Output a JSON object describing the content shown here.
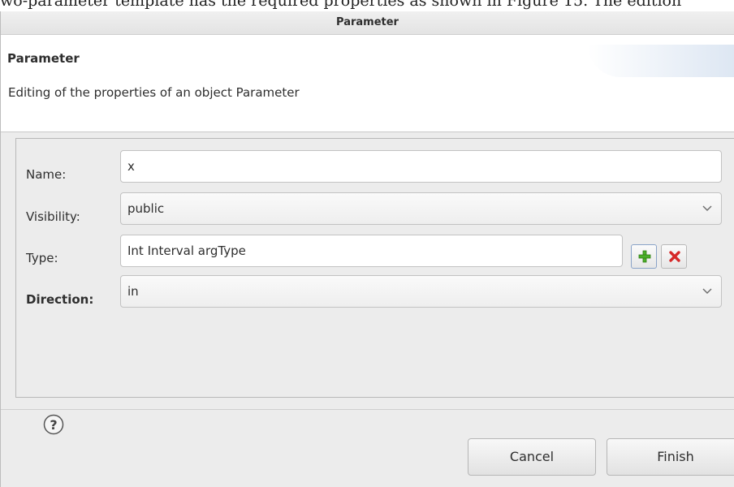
{
  "background": {
    "text": "wo-parameter template has the required properties as shown in Figure 15. The edition"
  },
  "window": {
    "title": "Parameter"
  },
  "banner": {
    "title": "Parameter",
    "description": "Editing of the properties of an object Parameter"
  },
  "form": {
    "name": {
      "label": "Name:",
      "value": "x"
    },
    "visibility": {
      "label": "Visibility:",
      "value": "public"
    },
    "type": {
      "label": "Type:",
      "value": "Int Interval argType",
      "add_icon": "add-icon",
      "remove_icon": "remove-icon"
    },
    "direction": {
      "label": "Direction:",
      "value": "in"
    }
  },
  "footer": {
    "help_icon": "help-icon",
    "cancel_label": "Cancel",
    "finish_label": "Finish"
  },
  "colors": {
    "add_green": "#4caf2a",
    "remove_red": "#d62828",
    "banner_gradient": "#d6e2f0"
  }
}
